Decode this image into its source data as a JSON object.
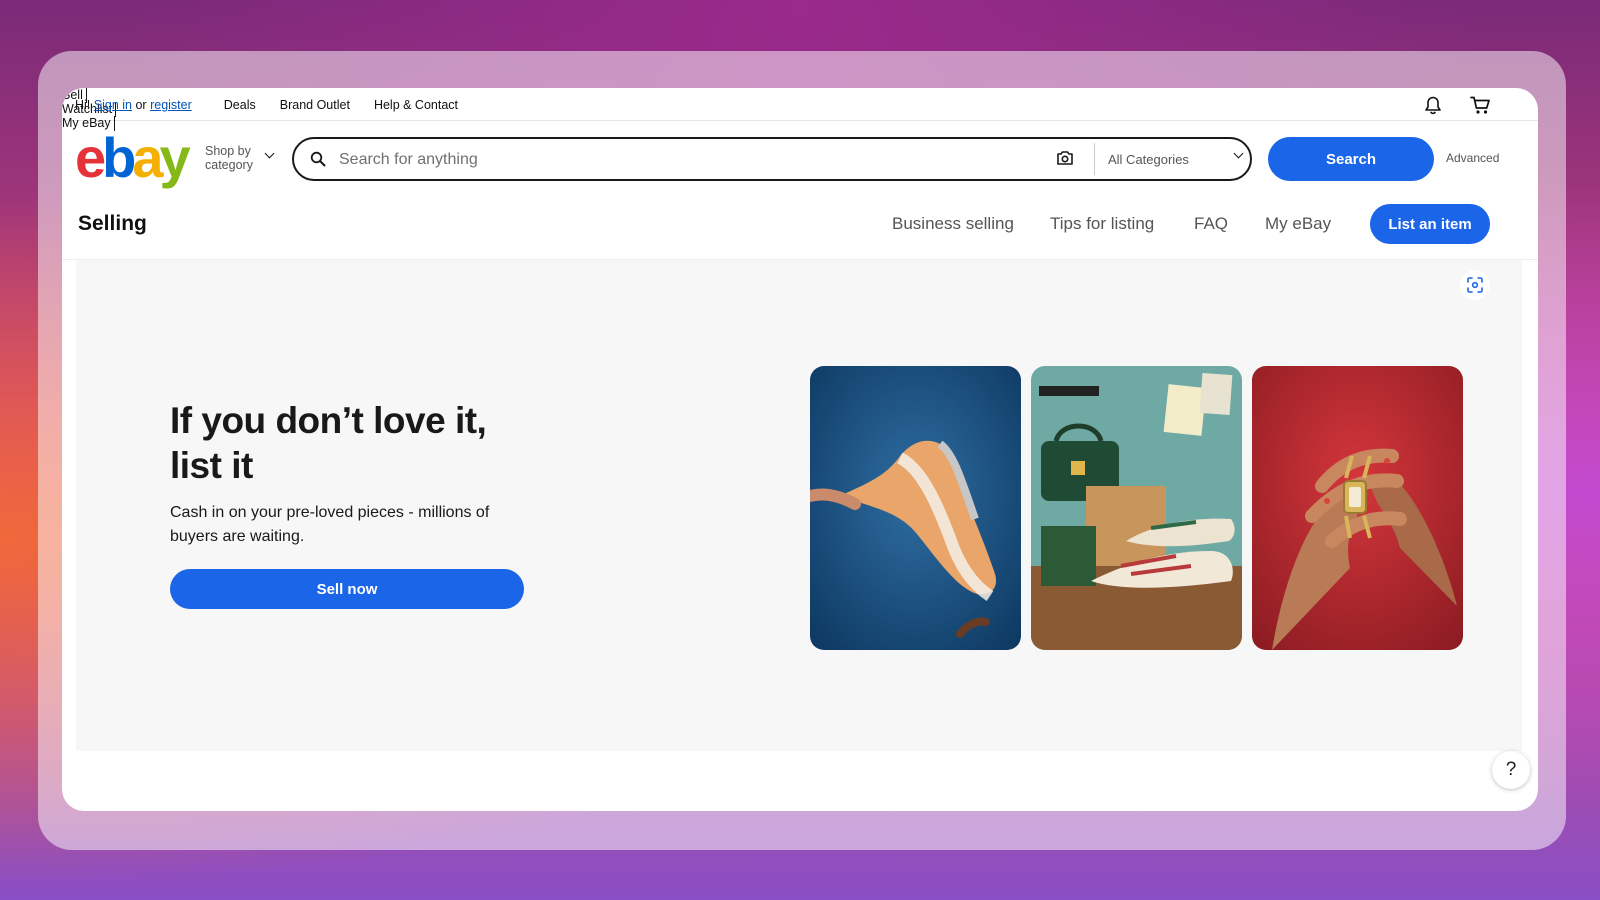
{
  "topbar": {
    "greeting": "Hi!",
    "sign_in": "Sign in",
    "or": "or",
    "register": "register",
    "links": [
      "Deals",
      "Brand Outlet",
      "Help & Contact"
    ],
    "sell": "Sell",
    "watchlist": "Watchlist",
    "my_ebay": "My eBay"
  },
  "header": {
    "logo": {
      "e": "e",
      "b": "b",
      "a": "a",
      "y": "y"
    },
    "shop_by_line1": "Shop by",
    "shop_by_line2": "category",
    "search_placeholder": "Search for anything",
    "category_selected": "All Categories",
    "search_button": "Search",
    "advanced": "Advanced"
  },
  "selling_nav": {
    "title": "Selling",
    "items": [
      "Business selling",
      "Tips for listing",
      "FAQ",
      "My eBay"
    ],
    "list_button": "List an item"
  },
  "hero": {
    "heading_line1": "If you don’t love it,",
    "heading_line2": "list it",
    "subtitle": "Cash in on your pre-loved pieces - millions of buyers are waiting.",
    "button": "Sell now"
  },
  "help": "?",
  "colors": {
    "accent": "#1a65e8",
    "logo_red": "#e53238",
    "logo_blue": "#0064d2",
    "logo_yellow": "#f5af02",
    "logo_green": "#86b817"
  },
  "icons": [
    "search-icon",
    "camera-icon",
    "notification-bell-icon",
    "cart-icon",
    "visual-search-icon",
    "chevron-down-icon"
  ]
}
